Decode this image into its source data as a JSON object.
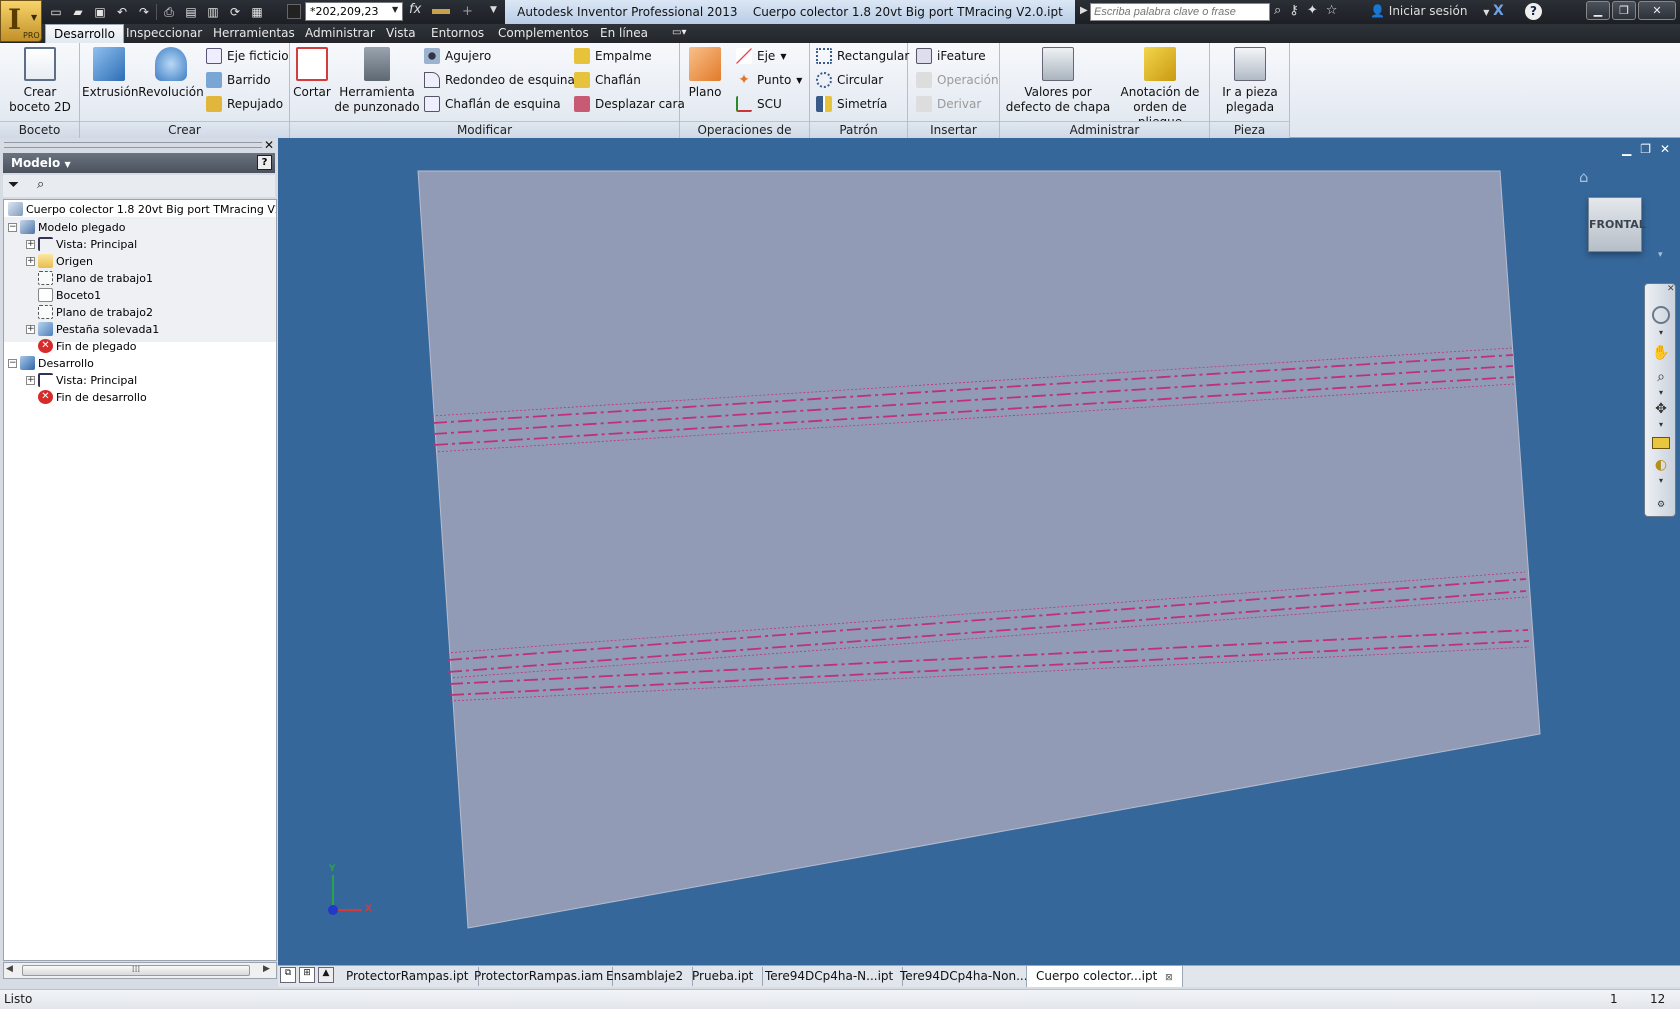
{
  "app": {
    "title": "Autodesk Inventor Professional 2013",
    "document_title": "Cuerpo colector 1.8 20vt Big port TMracing V2.0.ipt",
    "logo": "I",
    "edition": "PRO"
  },
  "quick_access": {
    "material_value": "*202,209,23",
    "fx_label": "fx"
  },
  "search": {
    "placeholder": "Escriba palabra clave o frase"
  },
  "user": {
    "sign_in_label": "Iniciar sesión"
  },
  "ribbon_tabs": [
    {
      "label": "Desarrollo"
    },
    {
      "label": "Inspeccionar"
    },
    {
      "label": "Herramientas"
    },
    {
      "label": "Administrar"
    },
    {
      "label": "Vista"
    },
    {
      "label": "Entornos"
    },
    {
      "label": "Complementos"
    },
    {
      "label": "En línea"
    }
  ],
  "ribbon": {
    "boceto": {
      "title": "Boceto",
      "crear_boceto": "Crear boceto 2D"
    },
    "crear": {
      "title": "Crear",
      "extrusion": "Extrusión",
      "revolucion": "Revolución",
      "eje_ficticio": "Eje ficticio",
      "barrido": "Barrido",
      "repujado": "Repujado"
    },
    "modificar": {
      "title": "Modificar",
      "cortar": "Cortar",
      "herramienta_punzonado": "Herramienta de punzonado",
      "agujero": "Agujero",
      "redondeo_esquina": "Redondeo de esquina",
      "chaflan_esquina": "Chaflán de esquina",
      "empalme": "Empalme",
      "chaflan": "Chaflán",
      "desplazar_cara": "Desplazar cara"
    },
    "operaciones": {
      "title": "Operaciones de trabajo",
      "plano": "Plano",
      "eje": "Eje",
      "punto": "Punto",
      "scu": "SCU"
    },
    "patron": {
      "title": "Patrón",
      "rectangular": "Rectangular",
      "circular": "Circular",
      "simetria": "Simetría"
    },
    "insertar": {
      "title": "Insertar",
      "ifeature": "iFeature",
      "operacion": "Operación",
      "derivar": "Derivar"
    },
    "administrar": {
      "title": "Administrar",
      "valores_defecto": "Valores por defecto de chapa",
      "anotacion_pliegue": "Anotación de orden de pliegue"
    },
    "pieza_plegada": {
      "title": "Pieza plegada",
      "ir_a": "Ir a pieza plegada"
    }
  },
  "browser": {
    "header": "Modelo",
    "help": "?",
    "tree": [
      {
        "label": "Cuerpo colector 1.8 20vt Big port TMracing V2.0.ipt",
        "icon": "part-icon"
      },
      {
        "label": "Modelo plegado",
        "icon": "folded-model-icon"
      },
      {
        "label": "Vista: Principal",
        "icon": "view-rep-icon"
      },
      {
        "label": "Origen",
        "icon": "folder-icon"
      },
      {
        "label": "Plano de trabajo1",
        "icon": "work-plane-icon"
      },
      {
        "label": "Boceto1",
        "icon": "sketch-icon"
      },
      {
        "label": "Plano de trabajo2",
        "icon": "work-plane-icon"
      },
      {
        "label": "Pestaña solevada1",
        "icon": "lofted-flange-icon"
      },
      {
        "label": "Fin de plegado",
        "icon": "end-of-folded-icon"
      },
      {
        "label": "Desarrollo",
        "icon": "flat-pattern-icon"
      },
      {
        "label": "Vista: Principal",
        "icon": "view-rep-icon"
      },
      {
        "label": "Fin de desarrollo",
        "icon": "end-of-flat-icon"
      }
    ]
  },
  "viewport": {
    "viewcube_label": "FRONTAL",
    "axis_x": "X",
    "axis_y": "Y",
    "background": "#35679b",
    "sheet_color": "#9aa0b9",
    "bend_line_color": "#c0307a"
  },
  "document_tabs": [
    {
      "label": "ProtectorRampas.ipt"
    },
    {
      "label": "ProtectorRampas.iam"
    },
    {
      "label": "Ensamblaje2"
    },
    {
      "label": "Prueba.ipt"
    },
    {
      "label": "Tere94DCp4ha-N...ipt"
    },
    {
      "label": "Tere94DCp4ha-Non..."
    },
    {
      "label": "Cuerpo colector...ipt"
    }
  ],
  "status": {
    "text": "Listo",
    "count1": "1",
    "count2": "12"
  }
}
